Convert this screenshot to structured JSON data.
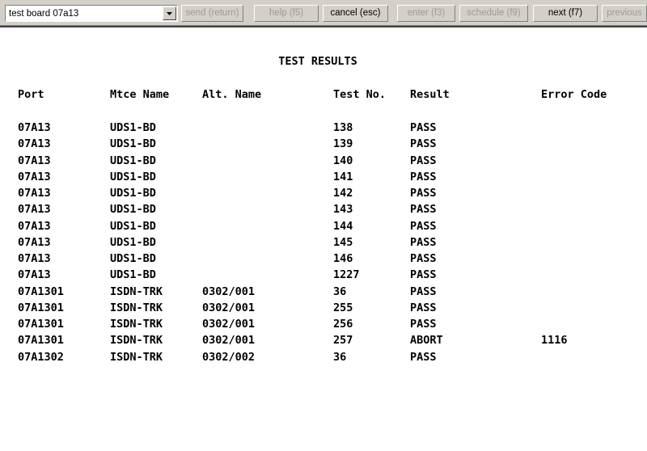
{
  "toolbar": {
    "command_value": "test board 07a13",
    "buttons": [
      {
        "label": "send (return)",
        "enabled": false
      },
      {
        "label": "help (f5)",
        "enabled": false
      },
      {
        "label": "cancel (esc)",
        "enabled": true
      },
      {
        "label": "enter (f3)",
        "enabled": false
      },
      {
        "label": "schedule (f9)",
        "enabled": false
      },
      {
        "label": "next (f7)",
        "enabled": true
      },
      {
        "label": "previous",
        "enabled": false
      }
    ]
  },
  "report": {
    "title": "TEST RESULTS",
    "columns": [
      "Port",
      "Mtce Name",
      "Alt. Name",
      "Test No.",
      "Result",
      "Error Code"
    ],
    "rows": [
      [
        "07A13",
        "UDS1-BD",
        "",
        "138",
        "PASS",
        ""
      ],
      [
        "07A13",
        "UDS1-BD",
        "",
        "139",
        "PASS",
        ""
      ],
      [
        "07A13",
        "UDS1-BD",
        "",
        "140",
        "PASS",
        ""
      ],
      [
        "07A13",
        "UDS1-BD",
        "",
        "141",
        "PASS",
        ""
      ],
      [
        "07A13",
        "UDS1-BD",
        "",
        "142",
        "PASS",
        ""
      ],
      [
        "07A13",
        "UDS1-BD",
        "",
        "143",
        "PASS",
        ""
      ],
      [
        "07A13",
        "UDS1-BD",
        "",
        "144",
        "PASS",
        ""
      ],
      [
        "07A13",
        "UDS1-BD",
        "",
        "145",
        "PASS",
        ""
      ],
      [
        "07A13",
        "UDS1-BD",
        "",
        "146",
        "PASS",
        ""
      ],
      [
        "07A13",
        "UDS1-BD",
        "",
        "1227",
        "PASS",
        ""
      ],
      [
        "07A1301",
        "ISDN-TRK",
        "0302/001",
        "36",
        "PASS",
        ""
      ],
      [
        "07A1301",
        "ISDN-TRK",
        "0302/001",
        "255",
        "PASS",
        ""
      ],
      [
        "07A1301",
        "ISDN-TRK",
        "0302/001",
        "256",
        "PASS",
        ""
      ],
      [
        "07A1301",
        "ISDN-TRK",
        "0302/001",
        "257",
        "ABORT",
        "1116"
      ],
      [
        "07A1302",
        "ISDN-TRK",
        "0302/002",
        "36",
        "PASS",
        ""
      ]
    ]
  }
}
